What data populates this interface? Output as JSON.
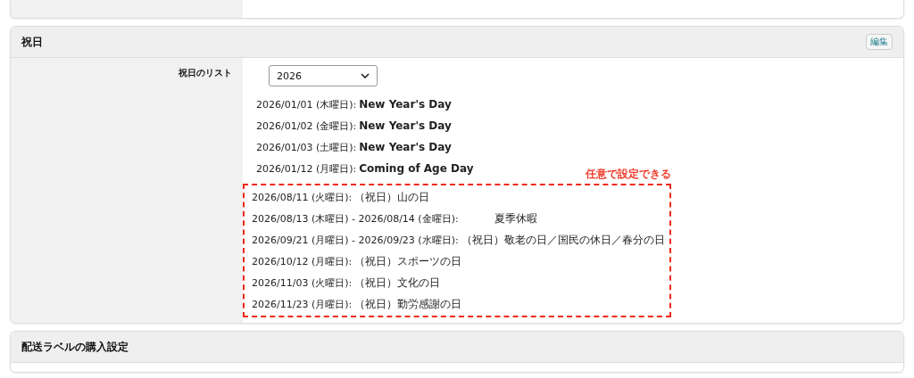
{
  "holidays_section": {
    "title": "祝日",
    "edit_button": "編集",
    "list_label": "祝日のリスト",
    "year_select": {
      "value": "2026"
    },
    "holidays": [
      {
        "date": "2026/01/01 (木曜日):",
        "name": "New Year's Day"
      },
      {
        "date": "2026/01/02 (金曜日):",
        "name": "New Year's Day"
      },
      {
        "date": "2026/01/03 (土曜日):",
        "name": "New Year's Day"
      },
      {
        "date": "2026/01/12 (月曜日):",
        "name": "Coming of Age Day"
      }
    ],
    "annotation": "任意で設定できる",
    "optional_holidays": [
      {
        "kind": "national",
        "date": "2026/08/11 (火曜日):",
        "name": "（祝日）山の日"
      },
      {
        "kind": "custom",
        "date": "2026/08/13 (木曜日) - 2026/08/14 (金曜日):",
        "name": "夏季休暇"
      },
      {
        "kind": "national",
        "date": "2026/09/21 (月曜日) - 2026/09/23 (水曜日):",
        "name": "（祝日）敬老の日／国民の休日／春分の日"
      },
      {
        "kind": "national",
        "date": "2026/10/12 (月曜日):",
        "name": "（祝日）スポーツの日"
      },
      {
        "kind": "national",
        "date": "2026/11/03 (火曜日):",
        "name": "（祝日）文化の日"
      },
      {
        "kind": "national",
        "date": "2026/11/23 (月曜日):",
        "name": "（祝日）勤労感謝の日"
      }
    ]
  },
  "label_section": {
    "title": "配送ラベルの購入設定"
  }
}
